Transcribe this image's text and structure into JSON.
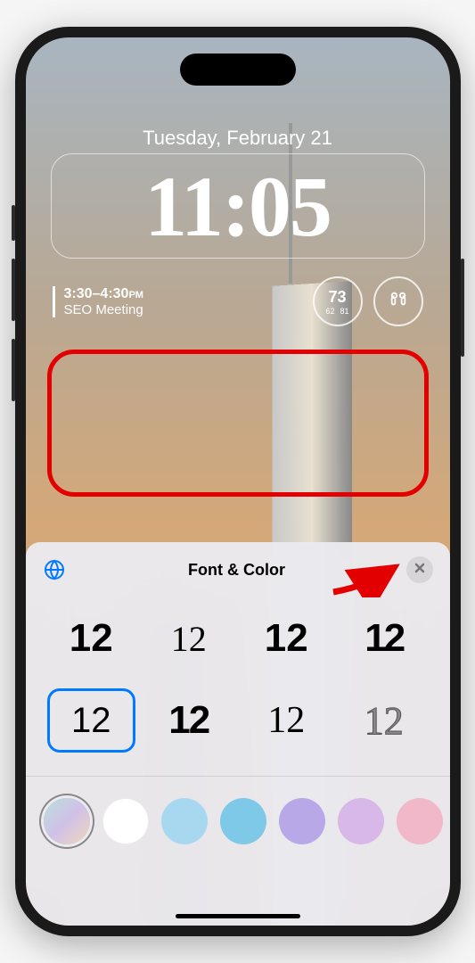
{
  "lockscreen": {
    "date": "Tuesday, February 21",
    "time": "11:05",
    "meeting": {
      "time": "3:30–4:30",
      "ampm": "PM",
      "title": "SEO Meeting"
    },
    "weather": {
      "temp": "73",
      "low": "62",
      "high": "81"
    }
  },
  "sheet": {
    "title": "Font & Color",
    "font_sample": "12",
    "fonts": [
      {
        "id": "f1",
        "selected": false
      },
      {
        "id": "f2",
        "selected": false
      },
      {
        "id": "f3",
        "selected": false
      },
      {
        "id": "f4",
        "selected": false
      },
      {
        "id": "f5",
        "selected": true
      },
      {
        "id": "f6",
        "selected": false
      },
      {
        "id": "f7",
        "selected": false
      },
      {
        "id": "f8",
        "selected": false
      }
    ],
    "colors": [
      {
        "hex": "linear-gradient(135deg,#b8e0d8,#d0c0e8,#f0d8b8)",
        "selected": true
      },
      {
        "hex": "#ffffff",
        "selected": false
      },
      {
        "hex": "#a8d8f0",
        "selected": false
      },
      {
        "hex": "#7ec8e8",
        "selected": false
      },
      {
        "hex": "#b8a8e8",
        "selected": false
      },
      {
        "hex": "#d8b8e8",
        "selected": false
      },
      {
        "hex": "#f0b8c8",
        "selected": false
      }
    ]
  }
}
